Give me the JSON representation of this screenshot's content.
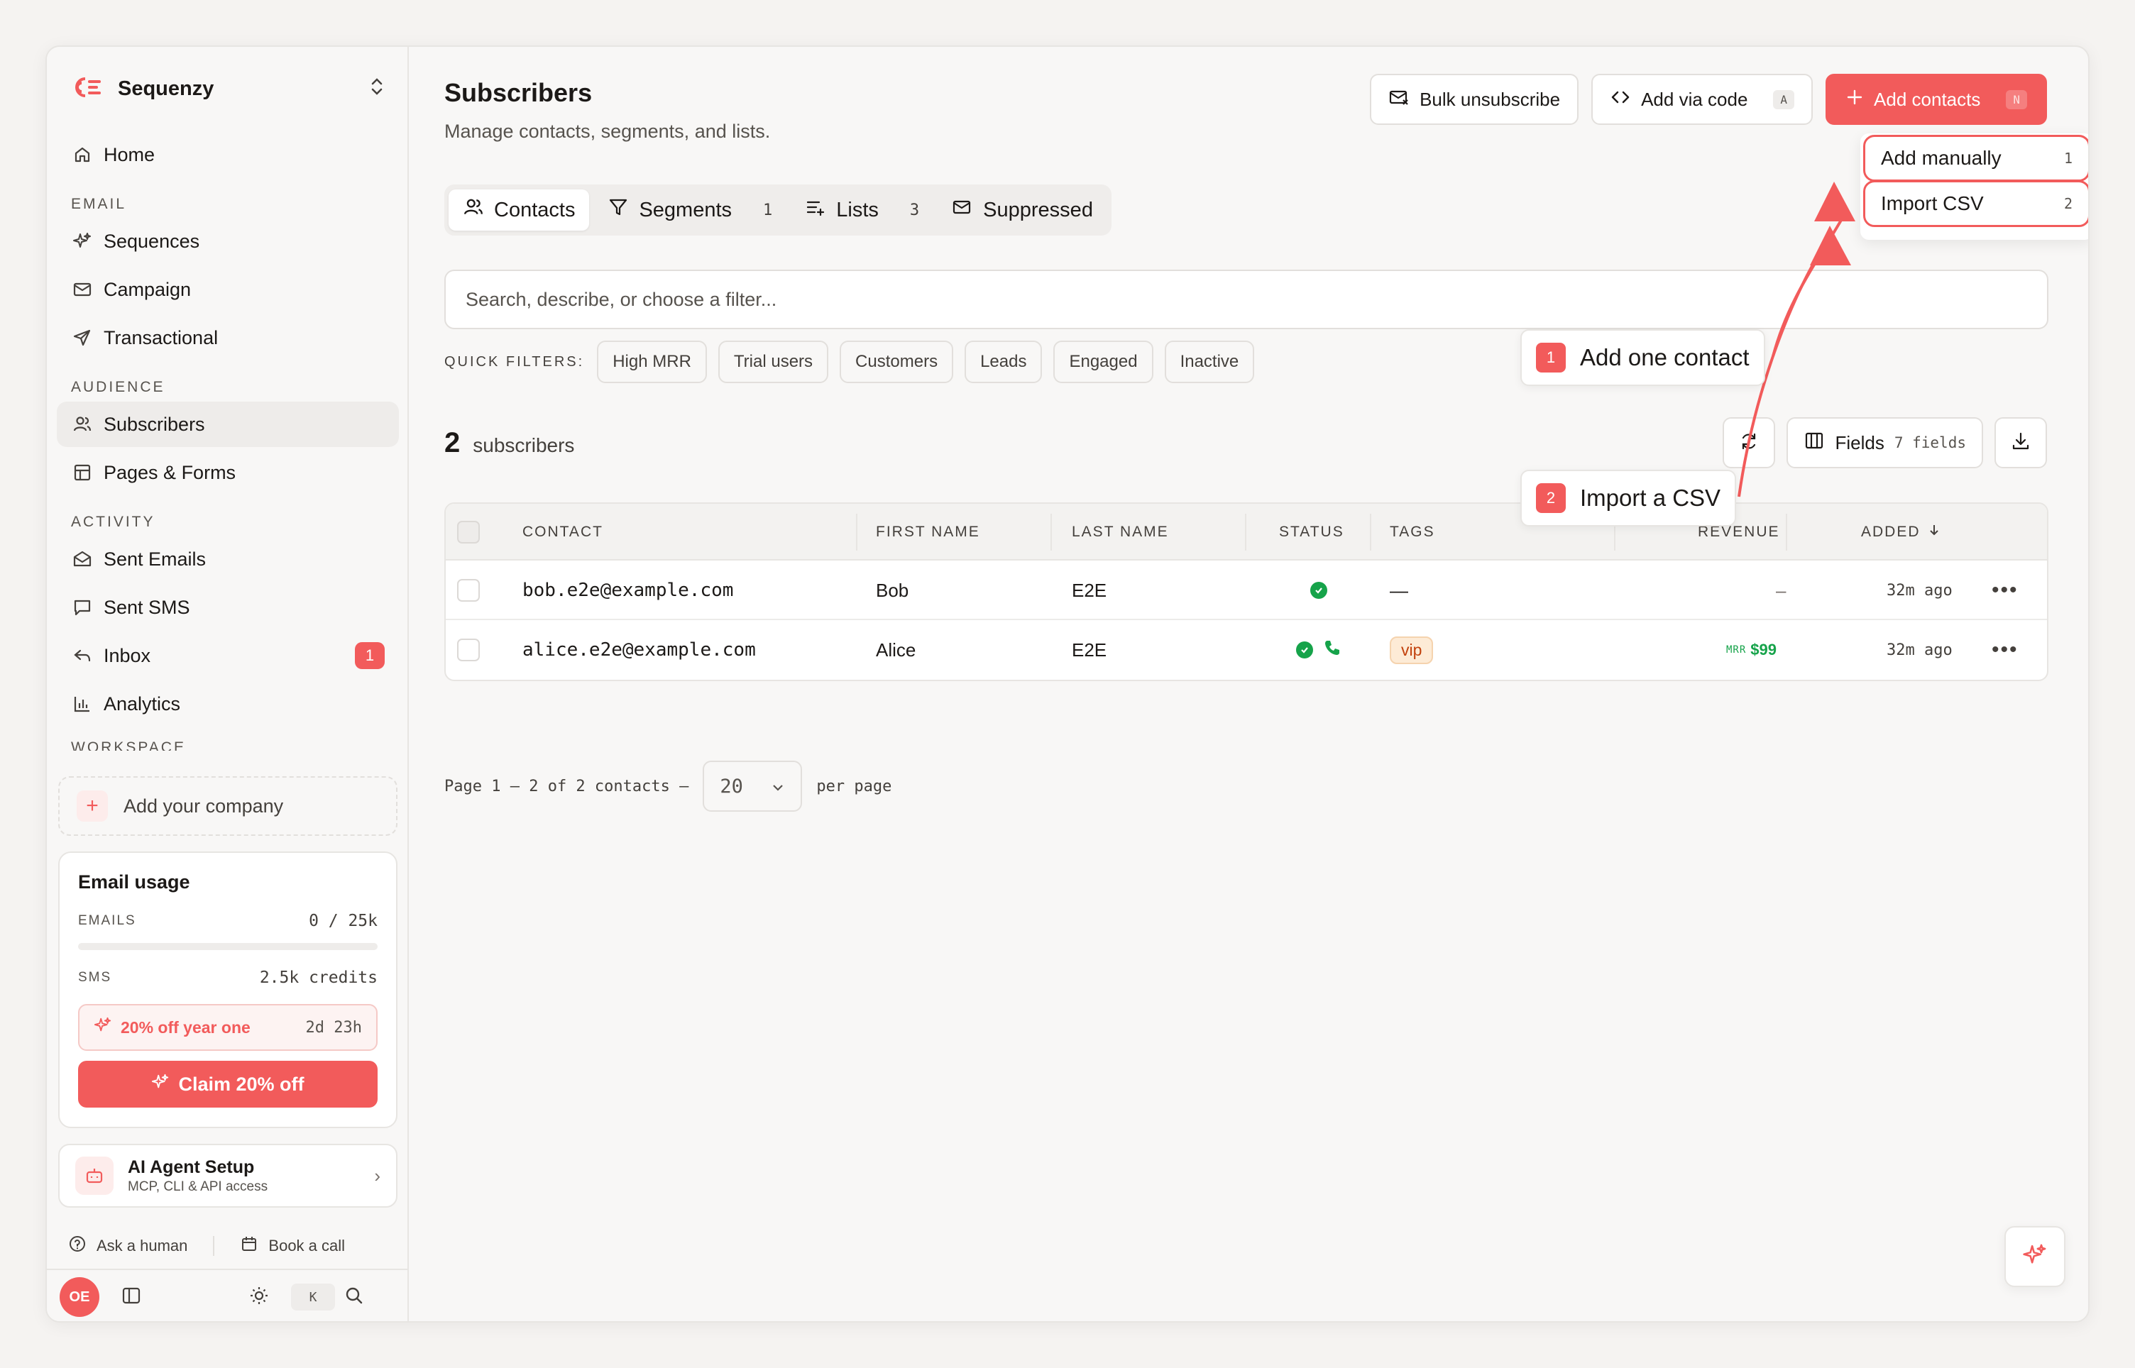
{
  "brand": {
    "name": "Sequenzy"
  },
  "sidebar": {
    "items_top": [
      {
        "label": "Home",
        "icon": "home-icon"
      }
    ],
    "sections": [
      {
        "title": "EMAIL",
        "items": [
          {
            "label": "Sequences",
            "icon": "sparkles-icon"
          },
          {
            "label": "Campaign",
            "icon": "mail-icon"
          },
          {
            "label": "Transactional",
            "icon": "send-icon"
          }
        ]
      },
      {
        "title": "AUDIENCE",
        "items": [
          {
            "label": "Subscribers",
            "icon": "users-icon",
            "active": true
          },
          {
            "label": "Pages & Forms",
            "icon": "layout-icon"
          }
        ]
      },
      {
        "title": "ACTIVITY",
        "items": [
          {
            "label": "Sent Emails",
            "icon": "mail-open-icon"
          },
          {
            "label": "Sent SMS",
            "icon": "message-icon"
          },
          {
            "label": "Inbox",
            "icon": "reply-icon",
            "badge": "1"
          },
          {
            "label": "Analytics",
            "icon": "bar-chart-icon"
          }
        ]
      },
      {
        "title": "WORKSPACE",
        "items": []
      }
    ],
    "add_company": "Add your company",
    "usage": {
      "title": "Email usage",
      "emails_label": "EMAILS",
      "emails_value": "0 / 25k",
      "emails_fraction": 0,
      "sms_label": "SMS",
      "sms_value": "2.5k credits",
      "promo_text": "20% off year one",
      "promo_time": "2d 23h",
      "claim_label": "Claim 20% off"
    },
    "agent": {
      "title": "AI Agent Setup",
      "subtitle": "MCP, CLI & API access"
    },
    "help": {
      "ask": "Ask a human",
      "book": "Book a call"
    },
    "footer": {
      "avatar": "OE",
      "kbd": "K"
    }
  },
  "header": {
    "title": "Subscribers",
    "subtitle": "Manage contacts, segments, and lists.",
    "bulk_unsubscribe": "Bulk unsubscribe",
    "add_via_code": "Add via code",
    "add_via_code_key": "A",
    "add_contacts": "Add contacts",
    "add_contacts_key": "N"
  },
  "dropdown": [
    {
      "label": "Add manually",
      "key": "1"
    },
    {
      "label": "Import CSV",
      "key": "2"
    }
  ],
  "tabs": [
    {
      "label": "Contacts",
      "count": ""
    },
    {
      "label": "Segments",
      "count": "1"
    },
    {
      "label": "Lists",
      "count": "3"
    },
    {
      "label": "Suppressed",
      "count": ""
    }
  ],
  "search": {
    "placeholder": "Search, describe, or choose a filter..."
  },
  "quick_filters": {
    "label": "QUICK FILTERS:",
    "chips": [
      "High MRR",
      "Trial users",
      "Customers",
      "Leads",
      "Engaged",
      "Inactive"
    ]
  },
  "summary": {
    "count": "2",
    "label": "subscribers"
  },
  "tools": {
    "fields": "Fields",
    "fields_count": "7 fields"
  },
  "table": {
    "columns": [
      "CONTACT",
      "FIRST NAME",
      "LAST NAME",
      "STATUS",
      "TAGS",
      "REVENUE",
      "ADDED"
    ],
    "rows": [
      {
        "contact": "bob.e2e@example.com",
        "first": "Bob",
        "last": "E2E",
        "tags": "—",
        "revenue": "–",
        "added": "32m ago"
      },
      {
        "contact": "alice.e2e@example.com",
        "first": "Alice",
        "last": "E2E",
        "tags": "vip",
        "revenue_prefix": "MRR",
        "revenue": "$99",
        "added": "32m ago"
      }
    ]
  },
  "pager": {
    "text": "Page 1 – 2 of 2 contacts –",
    "per_page_value": "20",
    "per_page_label": "per page"
  },
  "annotations": [
    {
      "n": "1",
      "label": "Add one contact"
    },
    {
      "n": "2",
      "label": "Import a CSV"
    }
  ],
  "colors": {
    "accent": "#f25b5b",
    "success": "#16a34a",
    "vip_bg": "#fdebd6"
  }
}
